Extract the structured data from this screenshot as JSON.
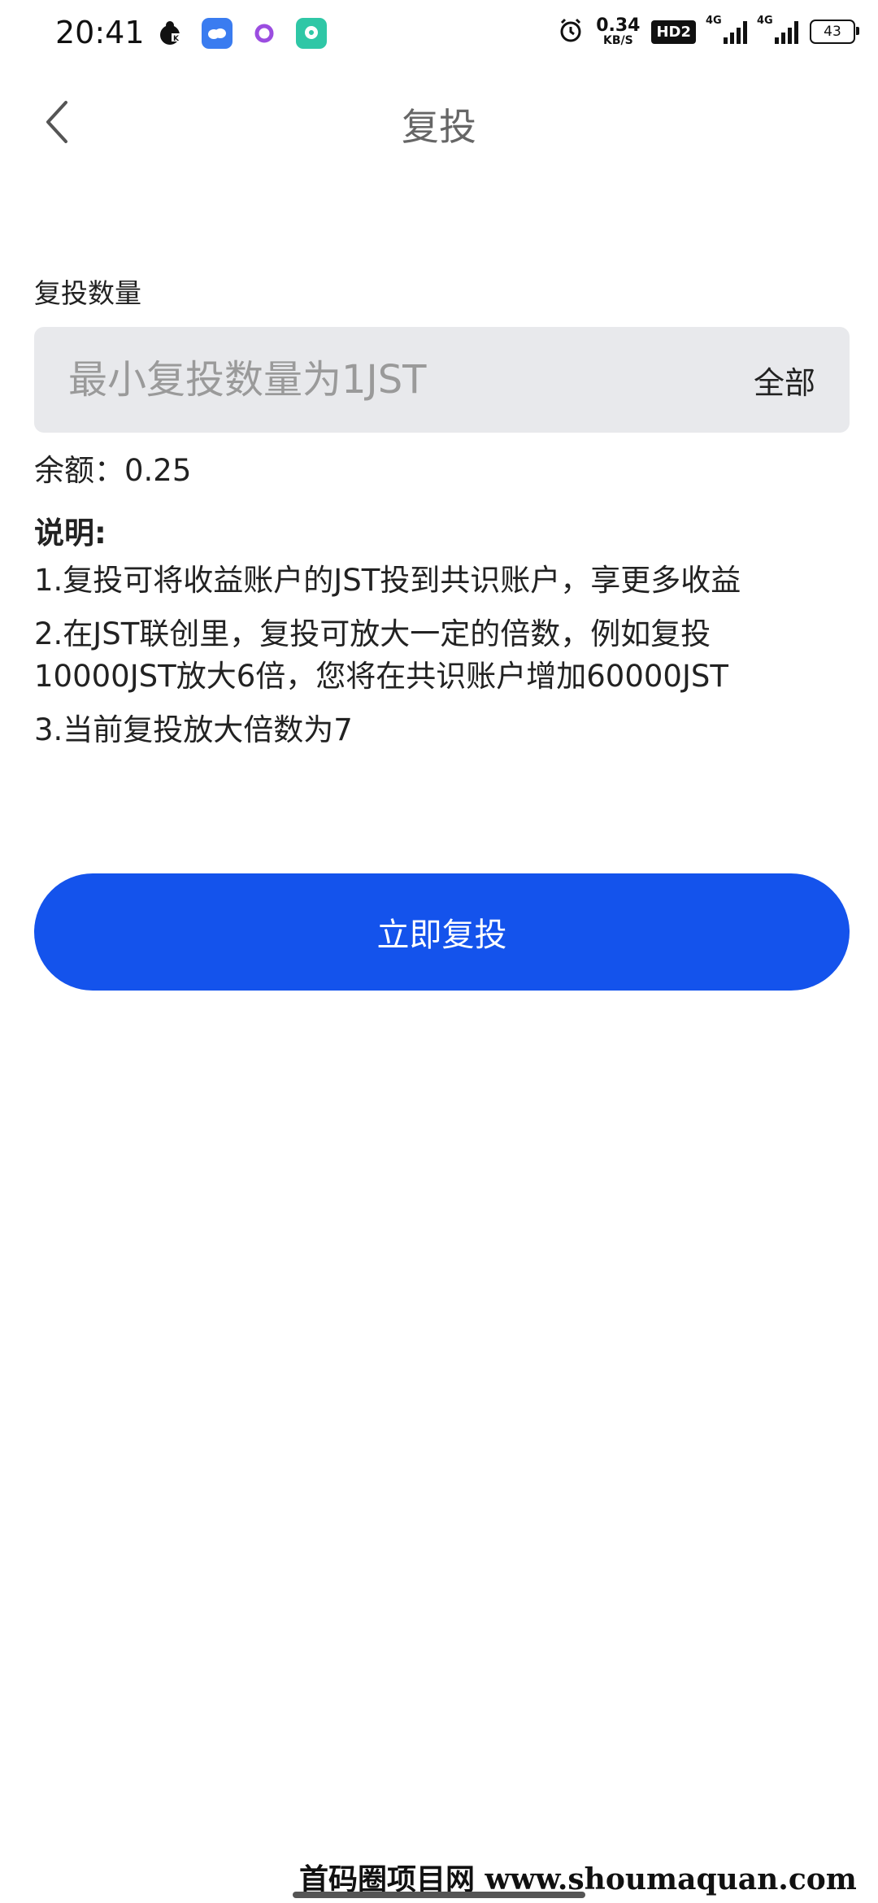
{
  "status_bar": {
    "time": "20:41",
    "net_speed_value": "0.34",
    "net_speed_unit": "KB/S",
    "hd_badge": "HD2",
    "signal1_label": "4G",
    "signal2_label": "4G",
    "battery": "43",
    "app_icons": [
      "bug-icon",
      "cloud-icon",
      "ring-icon",
      "chat-icon"
    ]
  },
  "header": {
    "title": "复投"
  },
  "form": {
    "label": "复投数量",
    "placeholder": "最小复投数量为1JST",
    "all_label": "全部",
    "balance_label": "余额：0.25"
  },
  "notes": {
    "title": "说明:",
    "items": [
      "1.复投可将收益账户的JST投到共识账户，享更多收益",
      "2.在JST联创里，复投可放大一定的倍数，例如复投10000JST放大6倍，您将在共识账户增加60000JST",
      "3.当前复投放大倍数为7"
    ]
  },
  "actions": {
    "submit_label": "立即复投"
  },
  "watermark": "首码圈项目网 www.shoumaquan.com",
  "colors": {
    "primary": "#1453ec",
    "input_bg": "#e8e9ec",
    "title": "#666666"
  }
}
